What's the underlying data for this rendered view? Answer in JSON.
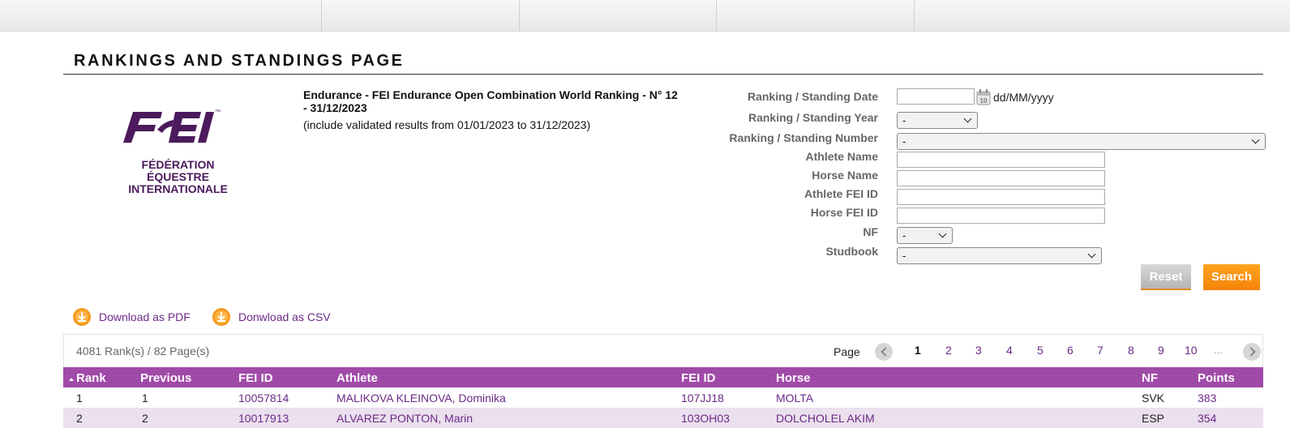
{
  "page": {
    "title": "RANKINGS AND STANDINGS PAGE"
  },
  "logo": {
    "text_lines": [
      "FÉDÉRATION",
      "ÉQUESTRE",
      "INTERNATIONALE"
    ],
    "brand_color": "#4b1a5c"
  },
  "ranking": {
    "title": "Endurance - FEI Endurance Open Combination World Ranking - N° 12 - 31/12/2023",
    "subtitle": "(include validated results from 01/01/2023 to 31/12/2023)"
  },
  "form": {
    "date_label": "Ranking / Standing Date",
    "date_value": "",
    "date_format": "dd/MM/yyyy",
    "calendar_icon_day": "10",
    "year_label": "Ranking / Standing Year",
    "year_value": "-",
    "number_label": "Ranking / Standing Number",
    "number_value": "-",
    "athlete_name_label": "Athlete Name",
    "horse_name_label": "Horse Name",
    "athlete_id_label": "Athlete FEI ID",
    "horse_id_label": "Horse FEI ID",
    "nf_label": "NF",
    "nf_value": "-",
    "studbook_label": "Studbook",
    "studbook_value": "-",
    "reset_label": "Reset",
    "search_label": "Search"
  },
  "downloads": {
    "pdf_label": "Download as PDF",
    "csv_label": "Donwload as CSV"
  },
  "pagination": {
    "count_text": "4081 Rank(s) / 82 Page(s)",
    "page_label": "Page",
    "current": "1",
    "pages": [
      "1",
      "2",
      "3",
      "4",
      "5",
      "6",
      "7",
      "8",
      "9",
      "10"
    ],
    "ellipsis": "..."
  },
  "table": {
    "headers": [
      "Rank",
      "Previous",
      "FEI ID",
      "Athlete",
      "FEI ID",
      "Horse",
      "NF",
      "Points"
    ],
    "rows": [
      [
        "1",
        "1",
        "10057814",
        "MALIKOVA KLEINOVA, Dominika",
        "107JJ18",
        "MOLTA",
        "SVK",
        "383"
      ],
      [
        "2",
        "2",
        "10017913",
        "ALVAREZ PONTON, Marin",
        "103OH03",
        "DOLCHOLEL AKIM",
        "ESP",
        "354"
      ]
    ]
  },
  "colors": {
    "header_purple": "#a04aa8",
    "link_purple": "#6b2a87",
    "search_orange": "#f5830a",
    "row_alt": "#ebe0ee"
  }
}
